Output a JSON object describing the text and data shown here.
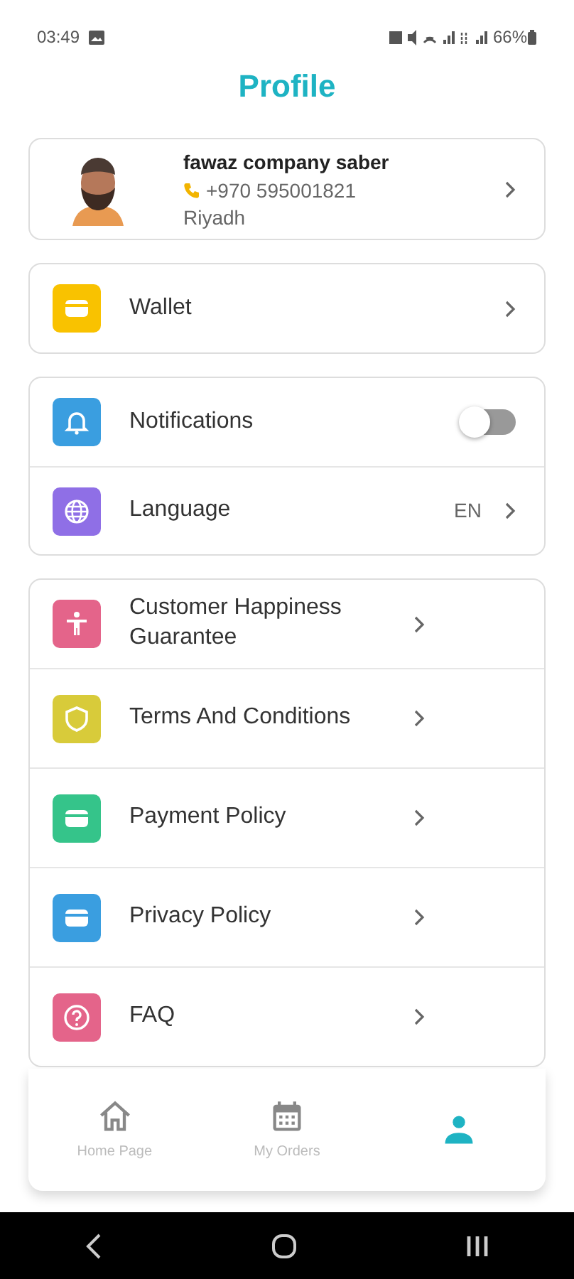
{
  "status_bar": {
    "time": "03:49",
    "battery": "66%"
  },
  "title": "Profile",
  "profile": {
    "name": "fawaz company saber",
    "phone": "+970 595001821",
    "city": "Riyadh"
  },
  "groups": [
    {
      "items": [
        {
          "kind": "link",
          "color": "#f9c200",
          "label": "Wallet"
        }
      ]
    },
    {
      "items": [
        {
          "kind": "toggle",
          "color": "#3a9ee0",
          "label": "Notifications",
          "on": false
        },
        {
          "kind": "value",
          "color": "#8f6fe6",
          "label": "Language",
          "value": "EN"
        }
      ]
    },
    {
      "items": [
        {
          "kind": "link",
          "color": "#e4648a",
          "label": "Customer Happiness Guarantee"
        },
        {
          "kind": "link",
          "color": "#d8cb3a",
          "label": "Terms And Conditions"
        },
        {
          "kind": "link",
          "color": "#35c48a",
          "label": "Payment Policy"
        },
        {
          "kind": "link",
          "color": "#3a9ee0",
          "label": "Privacy Policy"
        },
        {
          "kind": "link",
          "color": "#e4648a",
          "label": "FAQ"
        }
      ]
    }
  ],
  "bottom_nav": [
    {
      "label": "Home Page",
      "selected": false
    },
    {
      "label": "My Orders",
      "selected": false
    },
    {
      "selected": true
    }
  ]
}
